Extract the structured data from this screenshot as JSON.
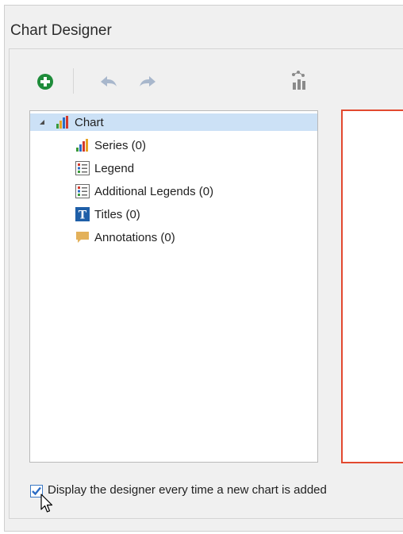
{
  "dialog": {
    "title": "Chart Designer"
  },
  "toolbar": {
    "add_icon": "plus-circle-icon",
    "undo_icon": "undo-arrow-icon",
    "redo_icon": "redo-arrow-icon",
    "chart_type_icon": "chart-type-icon",
    "add_color": "#1e8c3a",
    "undo_redo_color": "#a8b7cc"
  },
  "tree": {
    "items": [
      {
        "label": "Chart",
        "icon": "bar-chart-icon",
        "selected": true,
        "expanded": true
      },
      {
        "label": "Series (0)",
        "icon": "series-icon"
      },
      {
        "label": "Legend",
        "icon": "legend-icon"
      },
      {
        "label": "Additional Legends (0)",
        "icon": "legend-icon"
      },
      {
        "label": "Titles (0)",
        "icon": "title-icon"
      },
      {
        "label": "Annotations (0)",
        "icon": "annotation-icon"
      }
    ],
    "selection_color": "#cce1f6"
  },
  "preview": {
    "border_color": "#e2492f"
  },
  "footer": {
    "checkbox_label": "Display the designer every time a new chart is added",
    "checkbox_checked": true
  }
}
